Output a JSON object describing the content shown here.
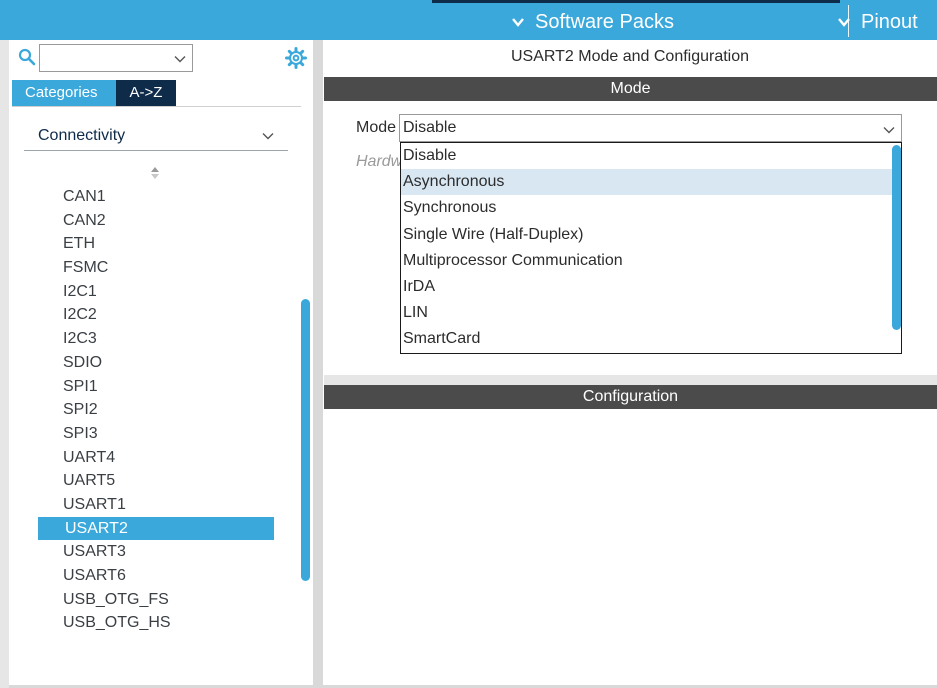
{
  "topbar": {
    "software_packs": "Software Packs",
    "pinout": "Pinout"
  },
  "left": {
    "tabs": {
      "categories": "Categories",
      "atoz": "A->Z"
    },
    "category": "Connectivity",
    "peripherals": [
      "CAN1",
      "CAN2",
      "ETH",
      "FSMC",
      "I2C1",
      "I2C2",
      "I2C3",
      "SDIO",
      "SPI1",
      "SPI2",
      "SPI3",
      "UART4",
      "UART5",
      "USART1",
      "USART2",
      "USART3",
      "USART6",
      "USB_OTG_FS",
      "USB_OTG_HS"
    ],
    "selected": "USART2"
  },
  "right": {
    "title": "USART2 Mode and Configuration",
    "mode_header": "Mode",
    "config_header": "Configuration",
    "mode_label": "Mode",
    "mode_value": "Disable",
    "hardware_label_partial": "Hardw",
    "mode_options": [
      "Disable",
      "Asynchronous",
      "Synchronous",
      "Single Wire (Half-Duplex)",
      "Multiprocessor Communication",
      "IrDA",
      "LIN",
      "SmartCard"
    ],
    "hovered_option": "Asynchronous"
  },
  "colors": {
    "accent": "#3aa8db",
    "navy": "#0f2b4a",
    "section_bar": "#4b4b4b",
    "hover": "#d9e7f3"
  }
}
